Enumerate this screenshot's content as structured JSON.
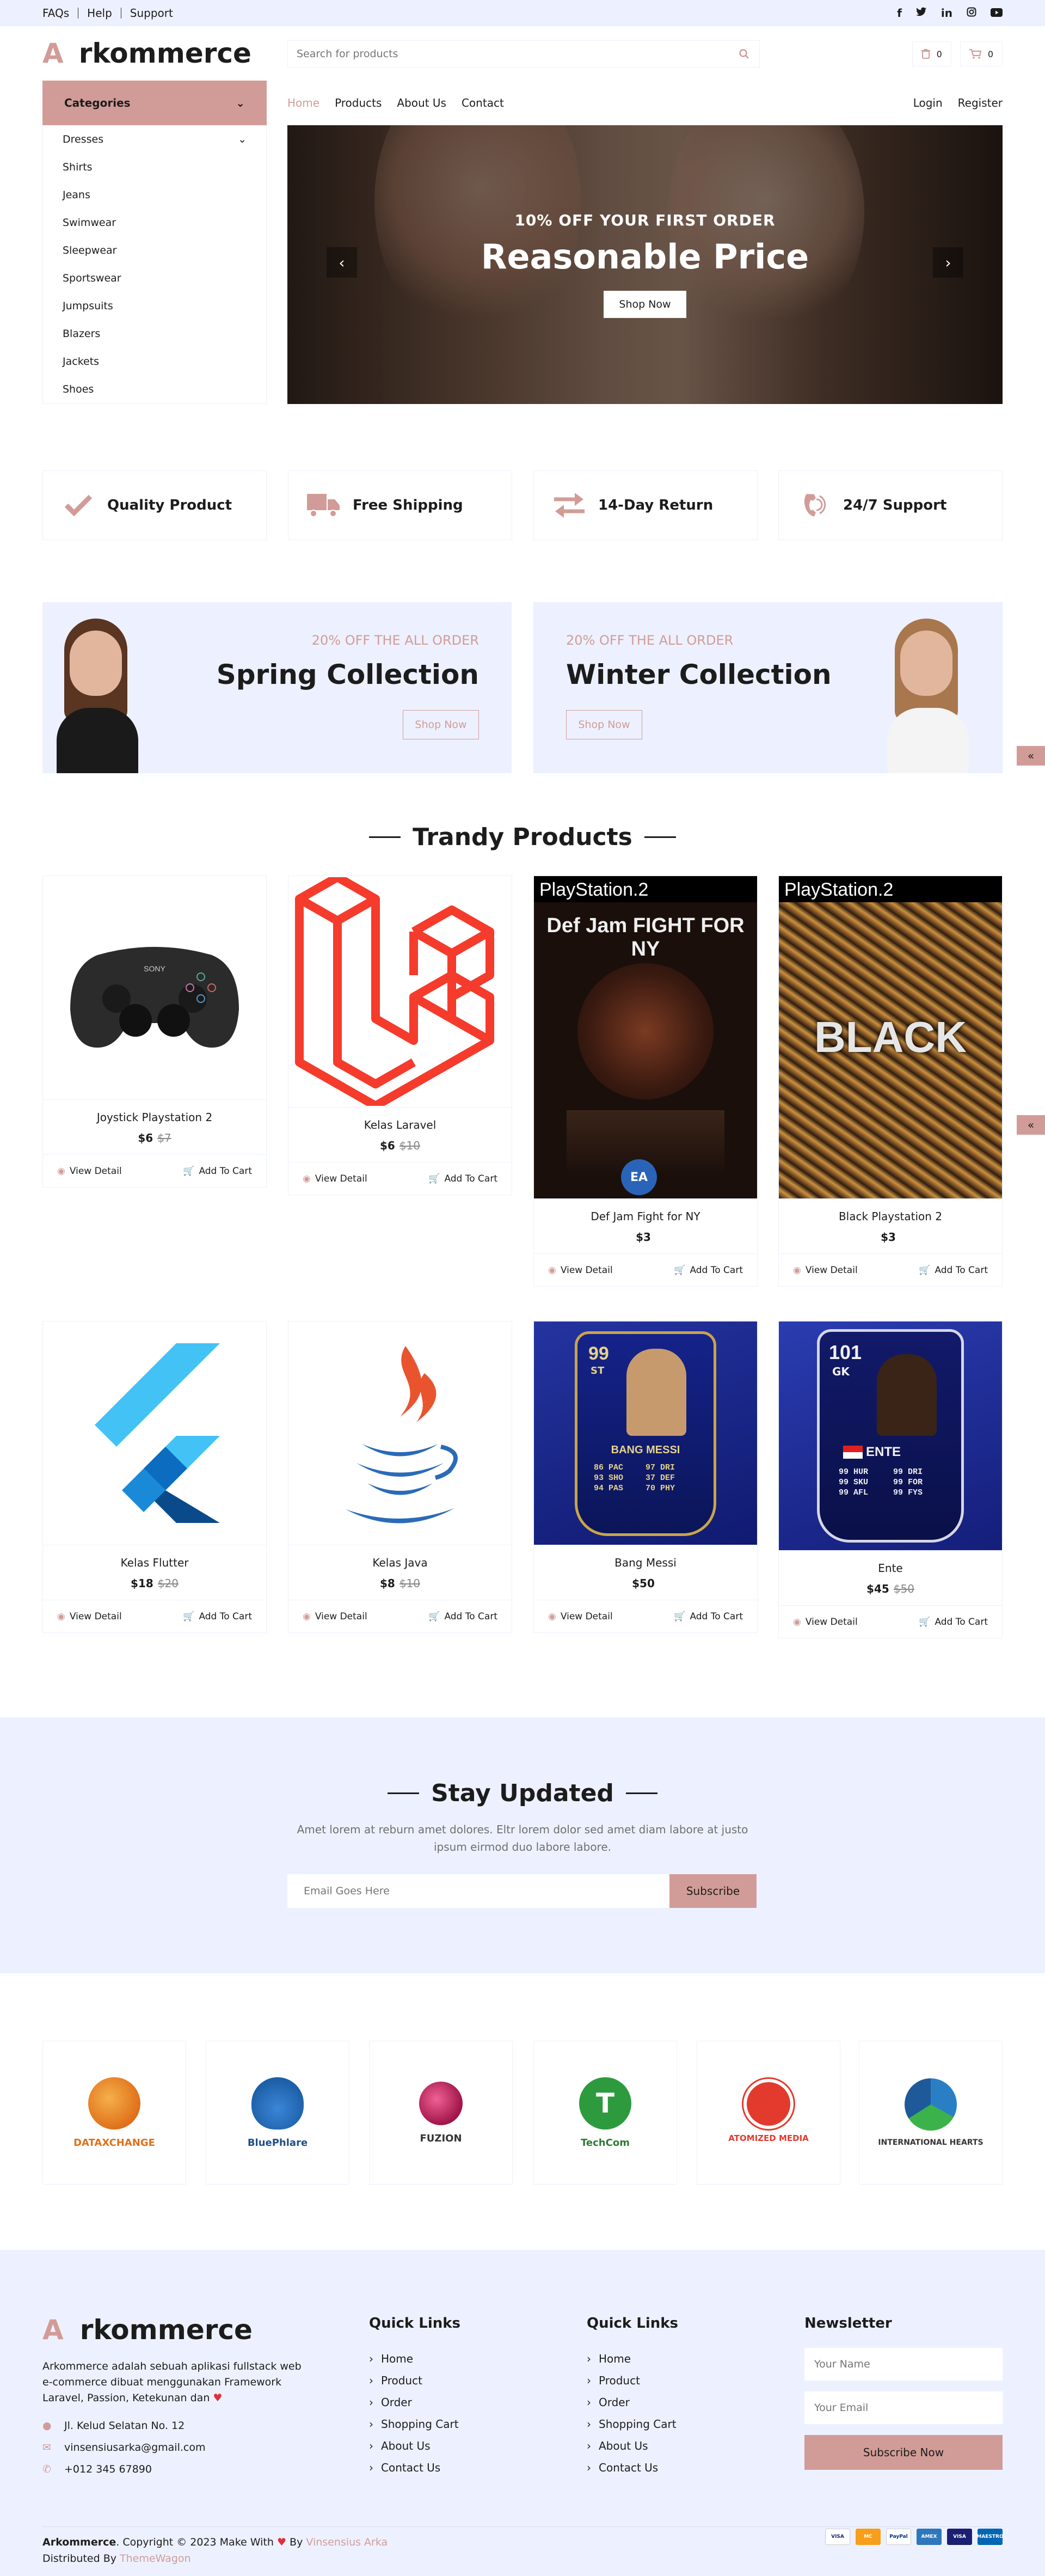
{
  "topbar": {
    "links": [
      "FAQs",
      "Help",
      "Support"
    ],
    "social_icons": [
      "facebook-icon",
      "twitter-icon",
      "linkedin-icon",
      "instagram-icon",
      "youtube-icon"
    ]
  },
  "header": {
    "logo_letter": "A",
    "logo_text": "rkommerce",
    "search_placeholder": "Search for products",
    "wishlist_count": "0",
    "cart_count": "0"
  },
  "categories": {
    "title": "Categories",
    "items": [
      "Dresses",
      "Shirts",
      "Jeans",
      "Swimwear",
      "Sleepwear",
      "Sportswear",
      "Jumpsuits",
      "Blazers",
      "Jackets",
      "Shoes"
    ]
  },
  "nav": {
    "links": [
      "Home",
      "Products",
      "About Us",
      "Contact"
    ],
    "active": "Home",
    "right": [
      "Login",
      "Register"
    ]
  },
  "hero": {
    "subtitle": "10% OFF YOUR FIRST ORDER",
    "title": "Reasonable Price",
    "button": "Shop Now"
  },
  "features": [
    {
      "icon": "check-icon",
      "label": "Quality Product"
    },
    {
      "icon": "truck-icon",
      "label": "Free Shipping"
    },
    {
      "icon": "exchange-icon",
      "label": "14-Day Return"
    },
    {
      "icon": "phone-volume-icon",
      "label": "24/7 Support"
    }
  ],
  "offers": [
    {
      "discount": "20% OFF THE ALL ORDER",
      "title": "Spring Collection",
      "button": "Shop Now"
    },
    {
      "discount": "20% OFF THE ALL ORDER",
      "title": "Winter Collection",
      "button": "Shop Now"
    }
  ],
  "trendy": {
    "title": "Trandy Products",
    "view_label": "View Detail",
    "cart_label": "Add To Cart",
    "products": [
      {
        "name": "Joystick Playstation 2",
        "price": "$6",
        "old_price": "$7"
      },
      {
        "name": "Kelas Laravel",
        "price": "$6",
        "old_price": "$10"
      },
      {
        "name": "Def Jam Fight for NY",
        "price": "$3",
        "old_price": ""
      },
      {
        "name": "Black Playstation 2",
        "price": "$3",
        "old_price": ""
      },
      {
        "name": "Kelas Flutter",
        "price": "$18",
        "old_price": "$20"
      },
      {
        "name": "Kelas Java",
        "price": "$8",
        "old_price": "$10"
      },
      {
        "name": "Bang Messi",
        "price": "$50",
        "old_price": ""
      },
      {
        "name": "Ente",
        "price": "$45",
        "old_price": "$50"
      }
    ],
    "image_text": {
      "ps2": "PlayStation.2",
      "defjam": "Def Jam FIGHT FOR NY",
      "black": "BLACK",
      "messi_rating": "99",
      "messi_pos": "ST",
      "messi_name": "BANG MESSI",
      "messi_stats": [
        "86 PAC",
        "97 DRI",
        "93 SHO",
        "37 DEF",
        "94 PAS",
        "70 PHY"
      ],
      "ente_rating": "101",
      "ente_pos": "GK",
      "ente_name": "ENTE",
      "ente_stats": [
        "99 HUR",
        "99 DRI",
        "99 SKU",
        "99 FOR",
        "99 AFL",
        "99 FYS"
      ]
    }
  },
  "newsletter": {
    "title": "Stay Updated",
    "desc": "Amet lorem at reburn amet dolores. Eltr lorem dolor sed amet diam labore at justo ipsum eirmod duo labore labore.",
    "placeholder": "Email Goes Here",
    "button": "Subscribe"
  },
  "vendors": [
    {
      "name": "DATAXCHANGE",
      "color": "#f0922a"
    },
    {
      "name": "BluePhlare",
      "color": "#1d5fa8"
    },
    {
      "name": "FUZION",
      "color": "#c2185b"
    },
    {
      "name": "TechCom",
      "color": "#2e9a3e"
    },
    {
      "name": "ATOMIZED MEDIA",
      "color": "#e23b2e"
    },
    {
      "name": "INTERNATIONAL HEARTS",
      "color": "#2a7fc4"
    }
  ],
  "footer": {
    "logo_letter": "A",
    "logo_text": "rkommerce",
    "desc": "Arkommerce adalah sebuah aplikasi fullstack web e-commerce dibuat menggunakan Framework Laravel, Passion, Ketekunan dan",
    "address": "Jl. Kelud Selatan No. 12",
    "email": "vinsensiusarka@gmail.com",
    "phone": "+012 345 67890",
    "col1_title": "Quick Links",
    "col1": [
      "Home",
      "Product",
      "Order",
      "Shopping Cart",
      "About Us",
      "Contact Us"
    ],
    "col2_title": "Quick Links",
    "col2": [
      "Home",
      "Product",
      "Order",
      "Shopping Cart",
      "About Us",
      "Contact Us"
    ],
    "news_title": "Newsletter",
    "name_placeholder": "Your Name",
    "email_placeholder": "Your Email",
    "subscribe": "Subscribe Now",
    "copy_brand": "Arkommerce",
    "copy_text": ". Copyright © 2023 Make With",
    "copy_by": "By",
    "copy_author": "Vinsensius Arka",
    "distributed": "Distributed By",
    "distributor": "ThemeWagon",
    "payments": [
      "VISA",
      "MC",
      "PayPal",
      "AMEX",
      "VISA",
      "MAESTRO"
    ]
  }
}
